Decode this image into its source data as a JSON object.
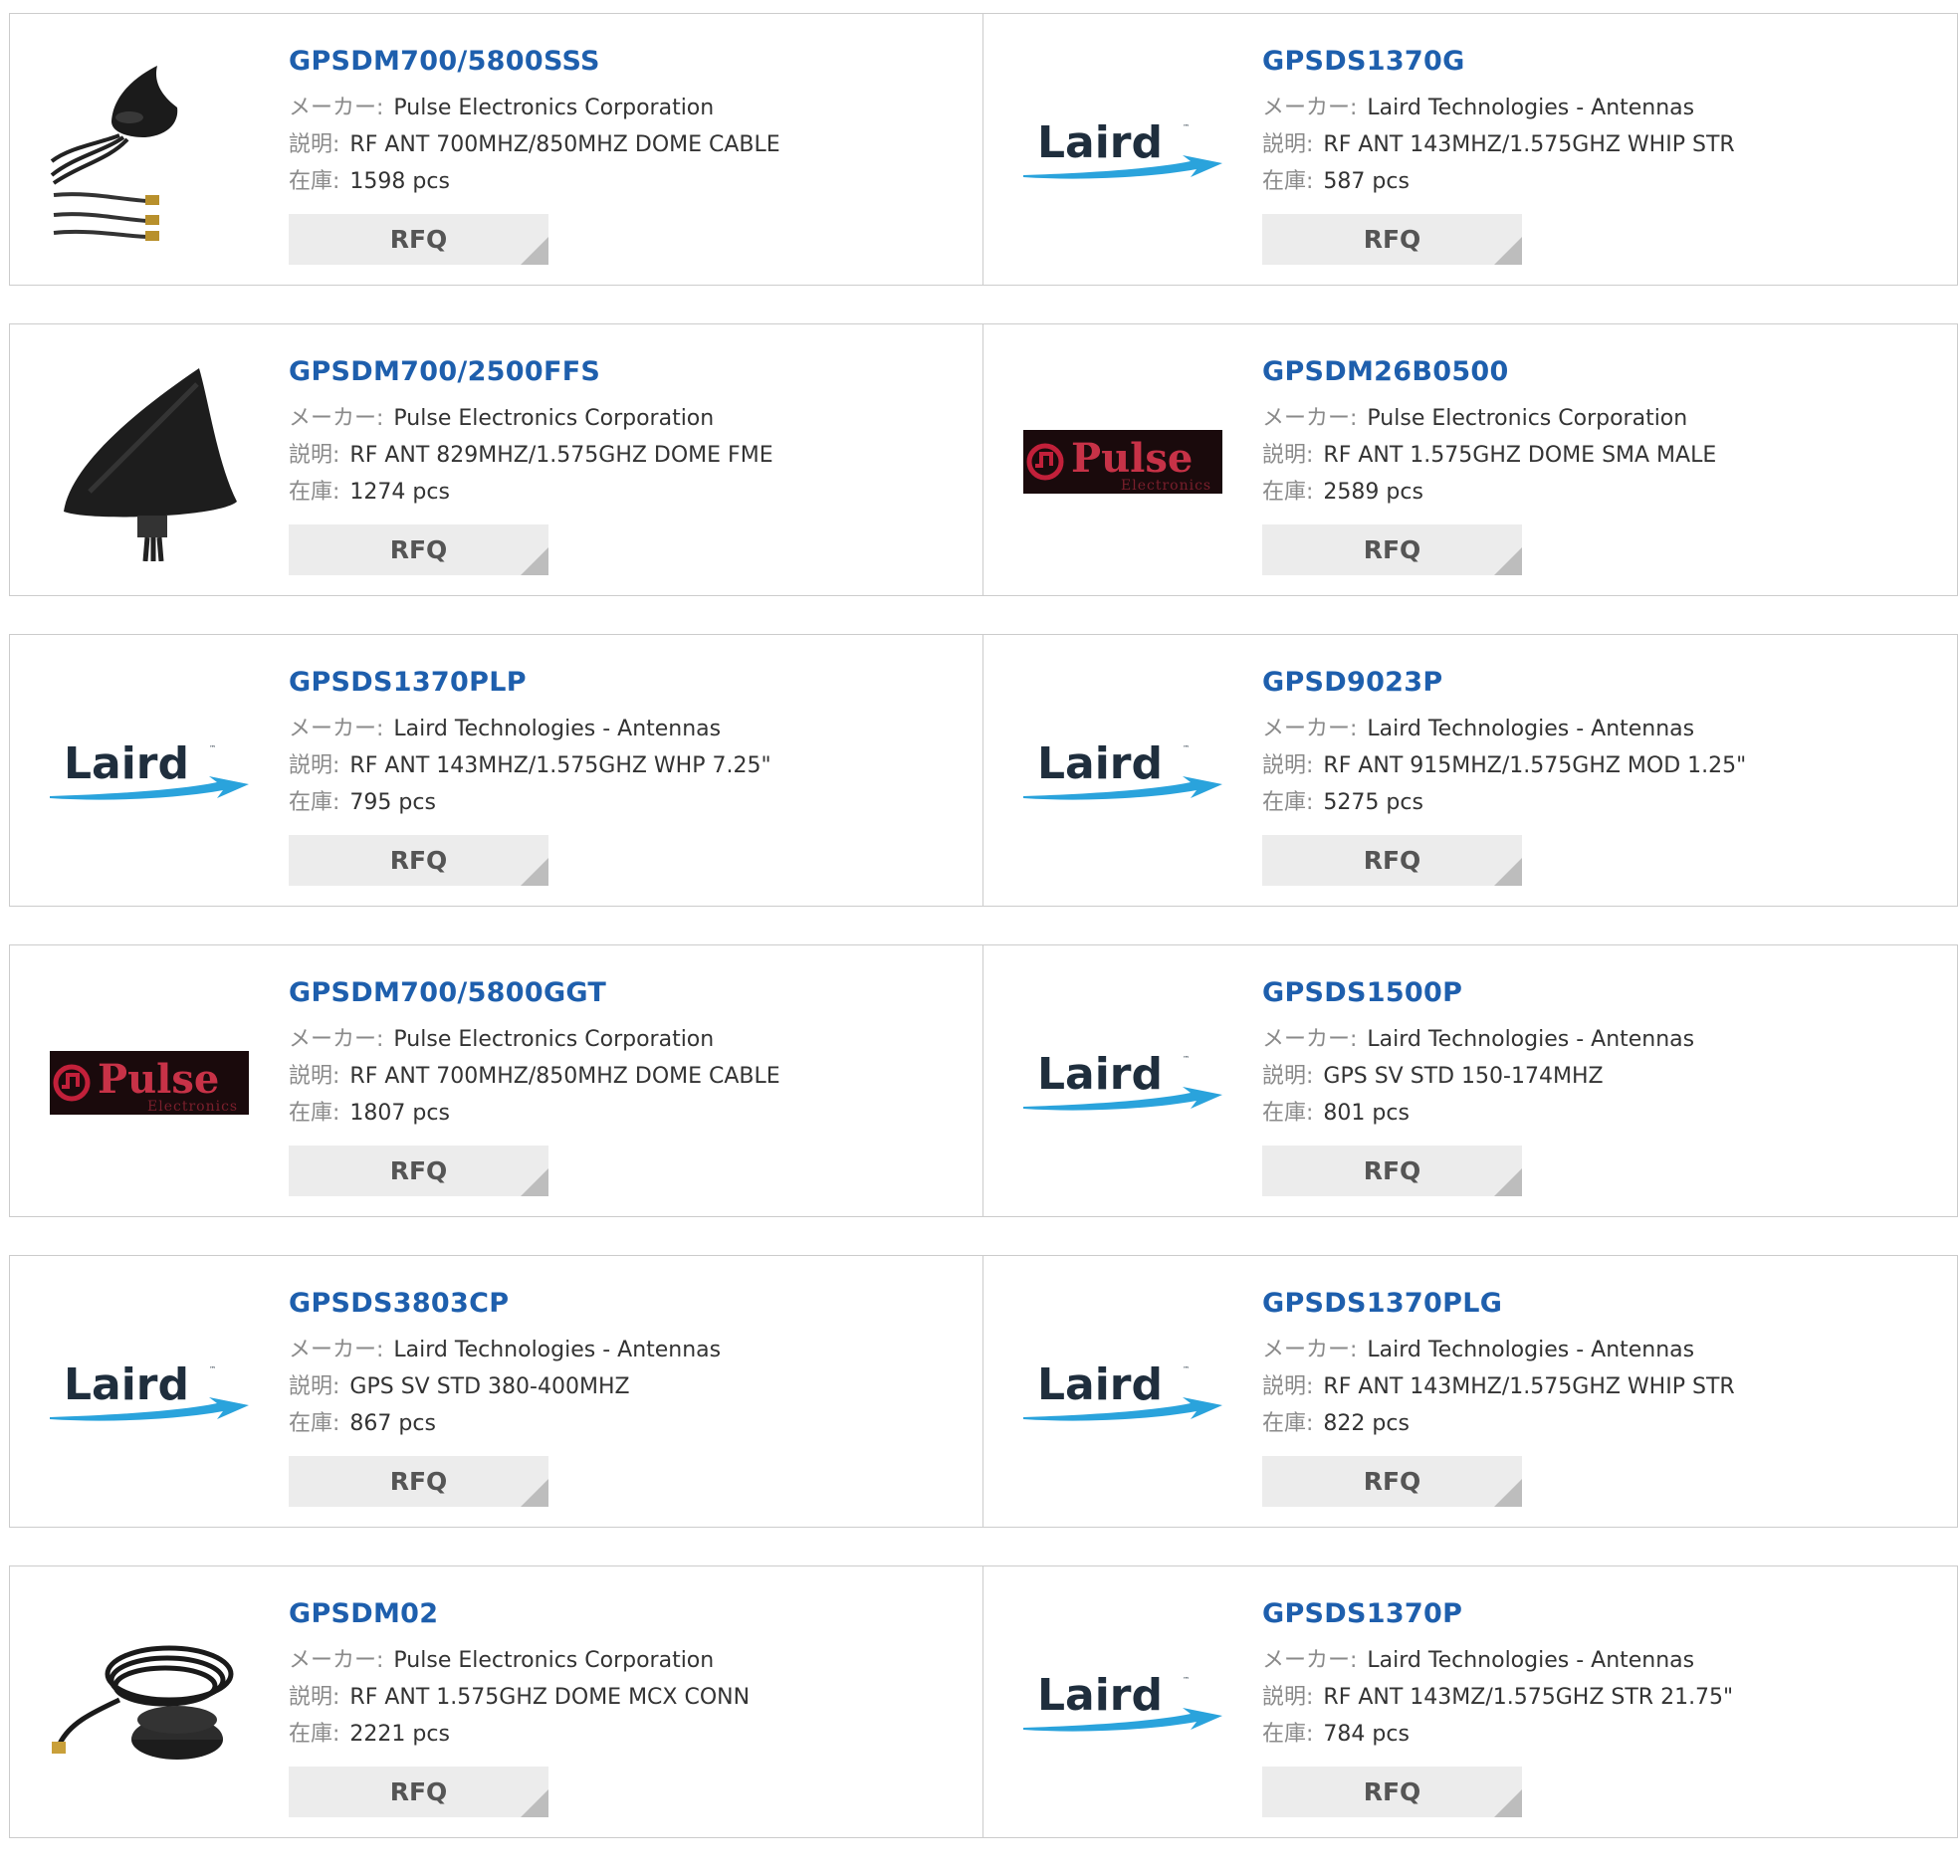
{
  "labels": {
    "manufacturer": "メーカー:",
    "description": "説明:",
    "stock": "在庫:",
    "rfq": "RFQ"
  },
  "logos": {
    "laird": "Laird",
    "pulse": "Pulse",
    "pulse_sub": "Electronics"
  },
  "products": [
    {
      "part": "GPSDM700/5800SSS",
      "manufacturer": "Pulse Electronics Corporation",
      "description": "RF ANT 700MHZ/850MHZ DOME CABLE",
      "stock": "1598 pcs",
      "image": "dome-cable-antenna-photo"
    },
    {
      "part": "GPSDS1370G",
      "manufacturer": "Laird Technologies - Antennas",
      "description": "RF ANT 143MHZ/1.575GHZ WHIP STR",
      "stock": "587 pcs",
      "image": "laird-logo"
    },
    {
      "part": "GPSDM700/2500FFS",
      "manufacturer": "Pulse Electronics Corporation",
      "description": "RF ANT 829MHZ/1.575GHZ DOME FME",
      "stock": "1274 pcs",
      "image": "shark-fin-antenna-photo"
    },
    {
      "part": "GPSDM26B0500",
      "manufacturer": "Pulse Electronics Corporation",
      "description": "RF ANT 1.575GHZ DOME SMA MALE",
      "stock": "2589 pcs",
      "image": "pulse-logo"
    },
    {
      "part": "GPSDS1370PLP",
      "manufacturer": "Laird Technologies - Antennas",
      "description": "RF ANT 143MHZ/1.575GHZ WHP 7.25\"",
      "stock": "795 pcs",
      "image": "laird-logo"
    },
    {
      "part": "GPSD9023P",
      "manufacturer": "Laird Technologies - Antennas",
      "description": "RF ANT 915MHZ/1.575GHZ MOD 1.25\"",
      "stock": "5275 pcs",
      "image": "laird-logo"
    },
    {
      "part": "GPSDM700/5800GGT",
      "manufacturer": "Pulse Electronics Corporation",
      "description": "RF ANT 700MHZ/850MHZ DOME CABLE",
      "stock": "1807 pcs",
      "image": "pulse-logo"
    },
    {
      "part": "GPSDS1500P",
      "manufacturer": "Laird Technologies - Antennas",
      "description": "GPS SV STD 150-174MHZ",
      "stock": "801 pcs",
      "image": "laird-logo"
    },
    {
      "part": "GPSDS3803CP",
      "manufacturer": "Laird Technologies - Antennas",
      "description": "GPS SV STD 380-400MHZ",
      "stock": "867 pcs",
      "image": "laird-logo"
    },
    {
      "part": "GPSDS1370PLG",
      "manufacturer": "Laird Technologies - Antennas",
      "description": "RF ANT 143MHZ/1.575GHZ WHIP STR",
      "stock": "822 pcs",
      "image": "laird-logo"
    },
    {
      "part": "GPSDM02",
      "manufacturer": "Pulse Electronics Corporation",
      "description": "RF ANT 1.575GHZ DOME MCX CONN",
      "stock": "2221 pcs",
      "image": "puck-antenna-photo"
    },
    {
      "part": "GPSDS1370P",
      "manufacturer": "Laird Technologies - Antennas",
      "description": "RF ANT 143MZ/1.575GHZ STR 21.75\"",
      "stock": "784 pcs",
      "image": "laird-logo"
    }
  ]
}
